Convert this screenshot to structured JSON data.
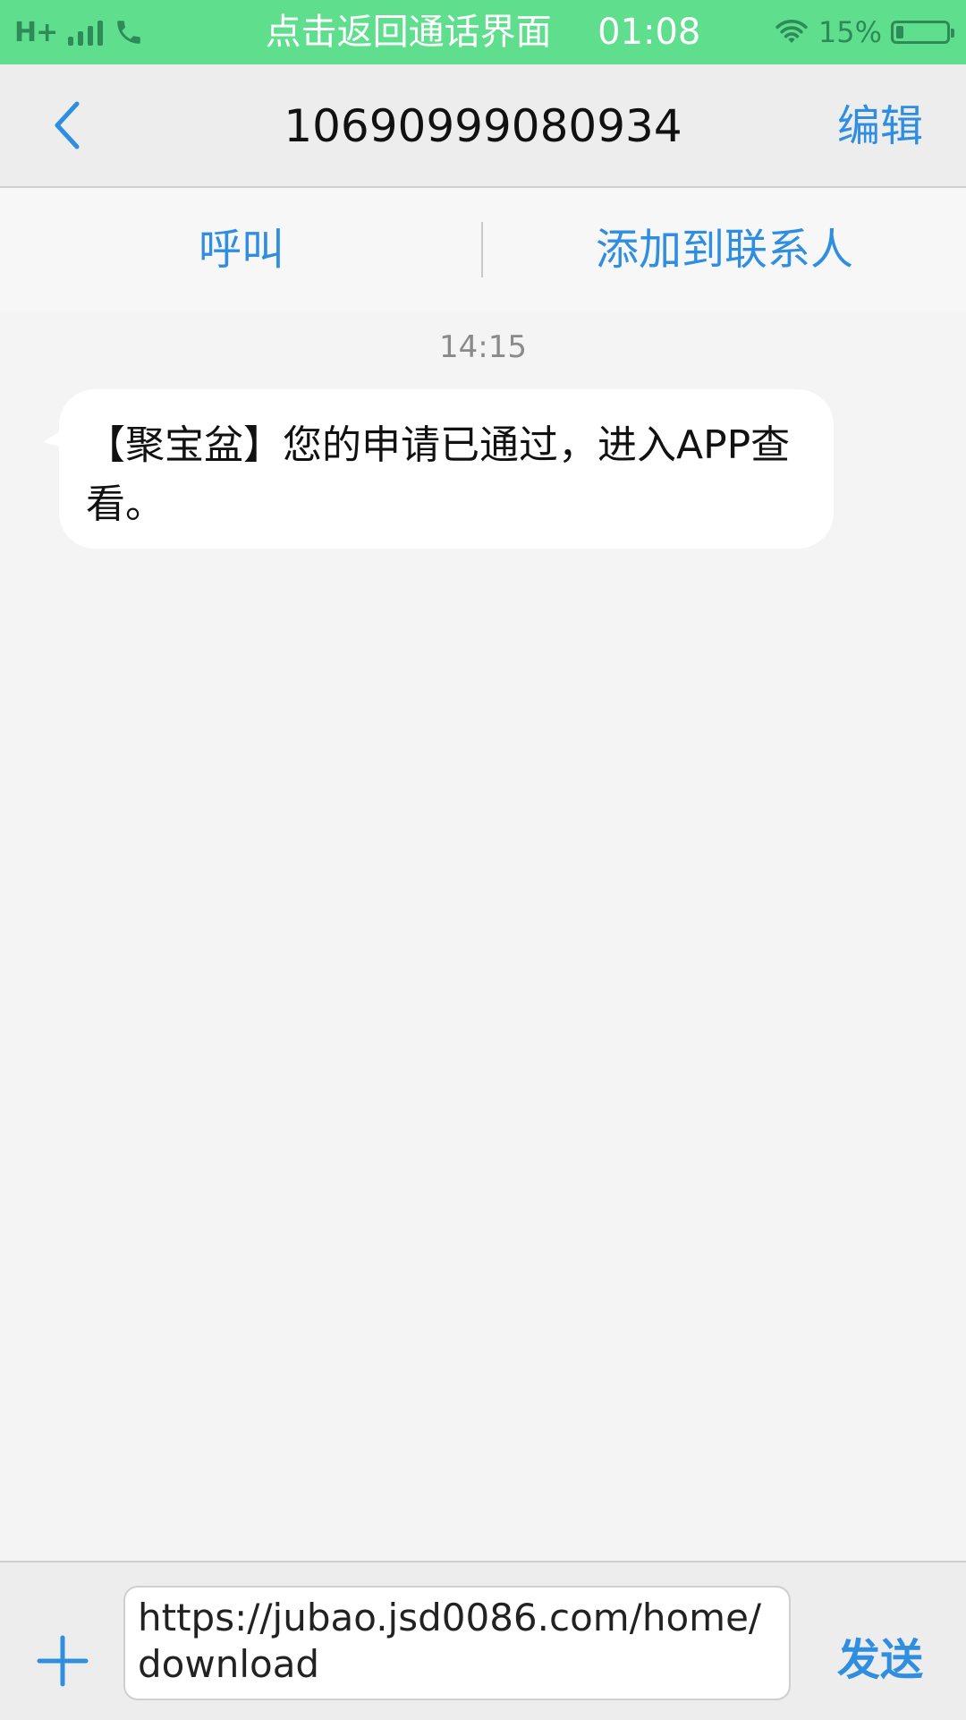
{
  "status_bar": {
    "network": "H+",
    "call_hint": "点击返回通话界面",
    "time": "01:08",
    "battery_percent": "15%",
    "battery_level": 0.15,
    "color": "#5fdf8e"
  },
  "nav": {
    "back_icon": "chevron-left-icon",
    "title": "10690999080934",
    "edit_label": "编辑"
  },
  "actions": {
    "call_label": "呼叫",
    "add_contact_label": "添加到联系人"
  },
  "conversation": {
    "timestamp": "14:15",
    "messages": [
      {
        "text": "【聚宝盆】您的申请已通过，进入APP查看。",
        "direction": "incoming"
      }
    ]
  },
  "composer": {
    "plus_icon": "plus-icon",
    "input_value": "https://jubao.jsd0086.com/home/download",
    "send_label": "发送"
  },
  "colors": {
    "accent": "#2f8ee0",
    "status_bar": "#5fdf8e"
  }
}
